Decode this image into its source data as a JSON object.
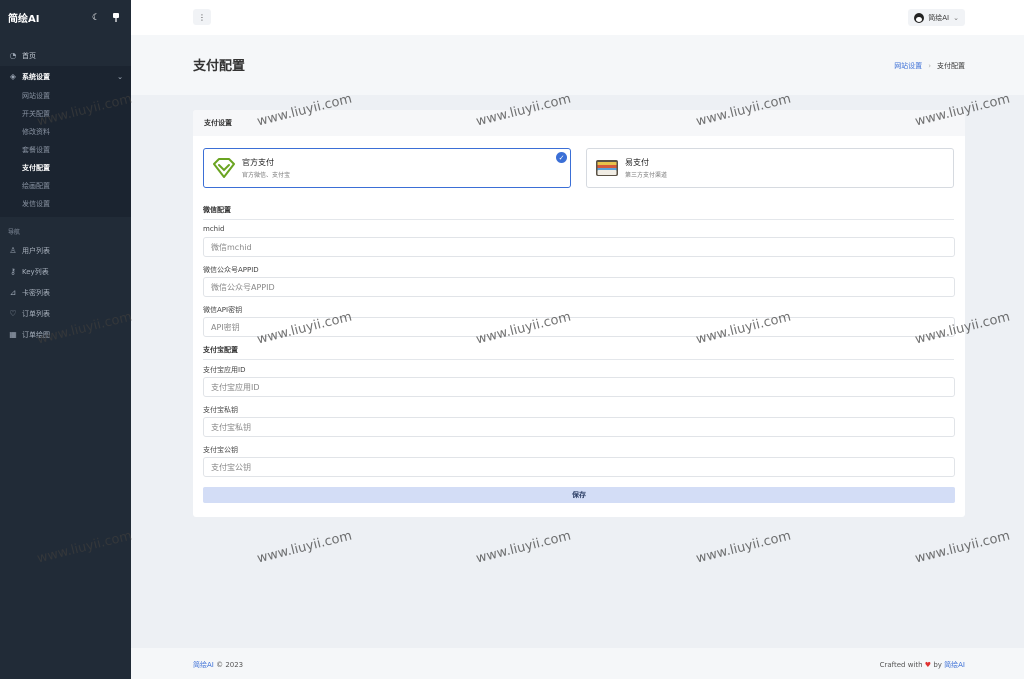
{
  "brand": {
    "name": "简绘AI",
    "theme_icon": "moon-icon",
    "pin_icon": "pin-icon"
  },
  "sidebar": {
    "home": "首页",
    "system_settings": "系统设置",
    "sub_items": [
      "网站设置",
      "开关配置",
      "修改资料",
      "套餐设置",
      "支付配置",
      "绘画配置",
      "发信设置"
    ],
    "current_sub": "支付配置",
    "nav_section": "导航",
    "nav_items": [
      {
        "label": "用户列表",
        "icon": "user-icon"
      },
      {
        "label": "Key列表",
        "icon": "key-icon"
      },
      {
        "label": "卡密列表",
        "icon": "card-icon"
      },
      {
        "label": "订单列表",
        "icon": "heart-icon"
      },
      {
        "label": "订单绘图",
        "icon": "image-icon"
      }
    ]
  },
  "header": {
    "user_name": "简绘AI"
  },
  "page": {
    "title": "支付配置",
    "breadcrumb": {
      "parent": "网站设置",
      "current": "支付配置"
    }
  },
  "payment": {
    "card_title": "支付设置",
    "options": [
      {
        "title": "官方支付",
        "desc": "官方微信、支付宝",
        "selected": true
      },
      {
        "title": "易支付",
        "desc": "第三方支付渠道",
        "selected": false
      }
    ],
    "wechat_section": "微信配置",
    "alipay_section": "支付宝配置",
    "fields": [
      {
        "label": "mchid",
        "placeholder": "微信mchid",
        "value": ""
      },
      {
        "label": "微信公众号APPID",
        "placeholder": "微信公众号APPID",
        "value": ""
      },
      {
        "label": "微信API密钥",
        "placeholder": "API密钥",
        "value": ""
      },
      {
        "label": "支付宝应用ID",
        "placeholder": "支付宝应用ID",
        "value": ""
      },
      {
        "label": "支付宝私钥",
        "placeholder": "支付宝私钥",
        "value": ""
      },
      {
        "label": "支付宝公钥",
        "placeholder": "支付宝公钥",
        "value": ""
      }
    ],
    "save_label": "保存"
  },
  "footer": {
    "brand": "简绘AI",
    "copyright": "© 2023",
    "crafted": "Crafted with",
    "by": "by",
    "by_brand": "简绘AI"
  },
  "watermark": "www.liuyii.com",
  "colors": {
    "sidebar_bg": "#212b37",
    "accent": "#3b6fd6",
    "save_bg": "#d3ddf6"
  }
}
